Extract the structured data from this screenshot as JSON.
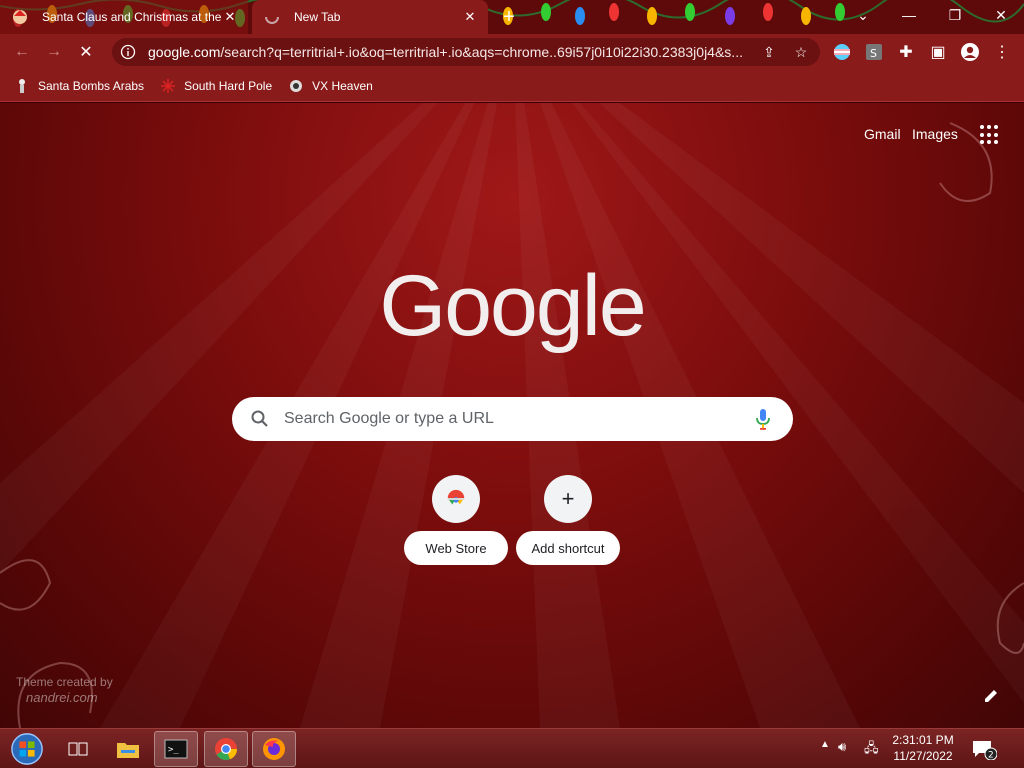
{
  "tabs": [
    {
      "title": "Santa Claus and Christmas at the",
      "active": false
    },
    {
      "title": "New Tab",
      "active": true
    }
  ],
  "toolbar": {
    "url_domain": "google.com",
    "url_rest": "/search?q=territrial+.io&oq=territrial+.io&aqs=chrome..69i57j0i10i22i30.2383j0j4&s..."
  },
  "bookmarks": [
    {
      "label": "Santa Bombs Arabs"
    },
    {
      "label": "South Hard Pole"
    },
    {
      "label": "VX Heaven"
    }
  ],
  "ntp": {
    "gmail": "Gmail",
    "images": "Images",
    "logo_text": "Google",
    "search_placeholder": "Search Google or type a URL",
    "shortcuts": [
      {
        "label": "Web Store"
      },
      {
        "label": "Add shortcut"
      }
    ],
    "credit_line1": "Theme created by",
    "credit_line2": "nandrei.com"
  },
  "taskbar": {
    "time": "2:31:01 PM",
    "date": "11/27/2022",
    "notifications": "2"
  },
  "colors": {
    "theme_red": "#8a1b1b",
    "ntp_red": "#7d0d0d"
  }
}
